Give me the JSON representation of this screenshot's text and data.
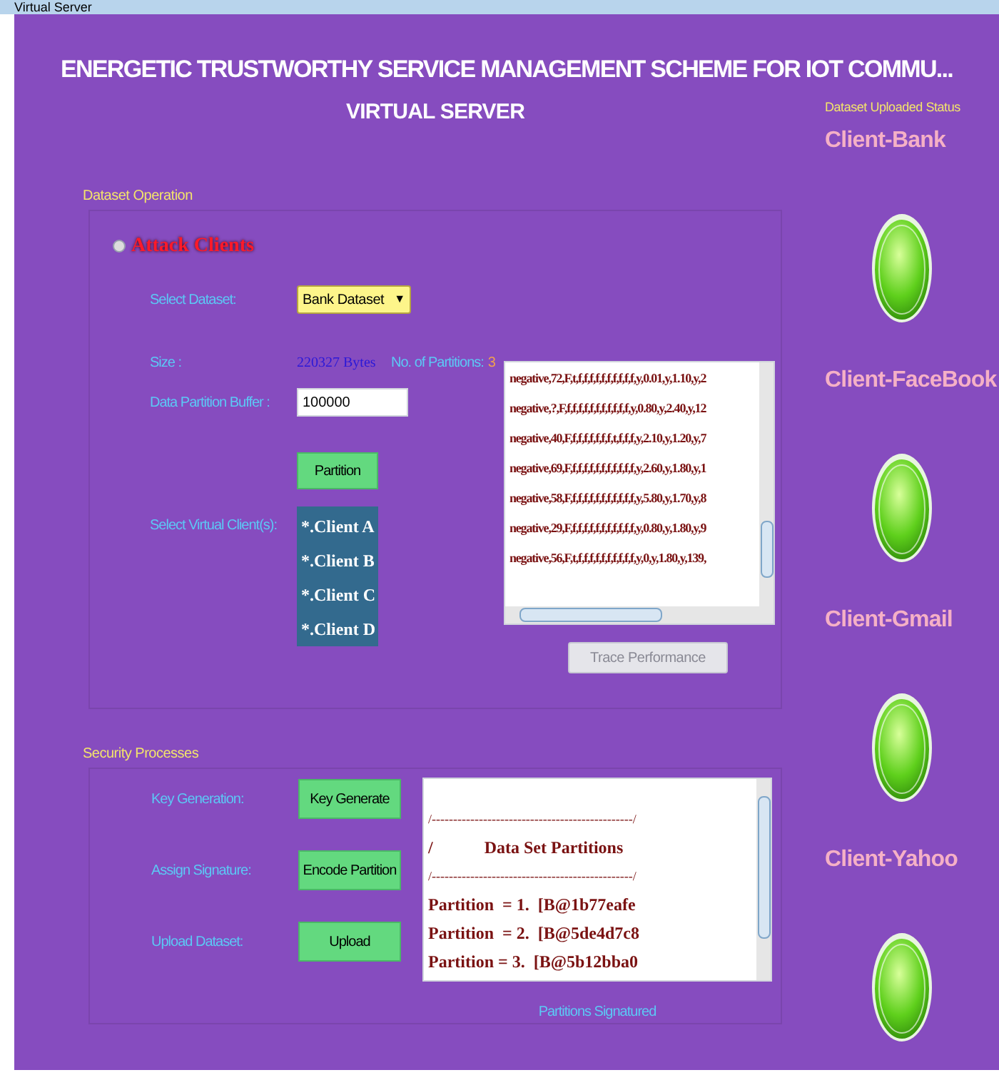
{
  "window": {
    "title": "Virtual Server"
  },
  "header": {
    "title": "ENERGETIC TRUSTWORTHY SERVICE MANAGEMENT SCHEME FOR IOT COMMU...",
    "subtitle": "VIRTUAL SERVER"
  },
  "dataset_operation": {
    "heading": "Dataset Operation",
    "attack_option": {
      "label": "Attack Clients",
      "selected": false
    },
    "select_dataset": {
      "label": "Select Dataset:",
      "value": "Bank Dataset",
      "arrow": "▼"
    },
    "size": {
      "label": "Size :",
      "value": "220327 Bytes"
    },
    "partitions": {
      "label": "No. of Partitions:",
      "value": "3"
    },
    "buffer": {
      "label": "Data Partition Buffer :",
      "value": "100000"
    },
    "partition_button": "Partition",
    "virtual_clients": {
      "label": "Select Virtual Client(s):",
      "items": [
        {
          "label": "*.Client A",
          "selected": false
        },
        {
          "label": "*.Client B",
          "selected": false
        },
        {
          "label": "*.Client C",
          "selected": false
        },
        {
          "label": "*.Client D",
          "selected": false
        }
      ]
    },
    "records": [
      "negative,72,F,t,f,f,f,f,f,f,f,f,f,f,y,0.01,y,1.10,y,2",
      "negative,?,F,f,f,f,f,f,f,f,f,f,f,f,y,0.80,y,2.40,y,12",
      "negative,40,F,f,f,f,f,f,f,f,t,f,f,f,y,2.10,y,1.20,y,7",
      "negative,69,F,f,f,f,f,f,f,f,f,f,f,f,y,2.60,y,1.80,y,1",
      "negative,58,F,f,f,f,f,f,f,f,f,f,f,f,y,5.80,y,1.70,y,8",
      "negative,29,F,f,f,f,f,f,f,f,f,f,f,f,y,0.80,y,1.80,y,9",
      "negative,56,F,t,f,f,f,f,f,f,f,f,f,f,y,0,y,1.80,y,139,"
    ],
    "trace_button": {
      "label": "Trace Performance",
      "disabled": true
    }
  },
  "security_processes": {
    "heading": "Security Processes",
    "steps": [
      {
        "label": "Key Generation:",
        "button": "Key Generate"
      },
      {
        "label": "Assign Signature:",
        "button": "Encode Partition"
      },
      {
        "label": "Upload Dataset:",
        "button": "Upload"
      }
    ],
    "log": [
      {
        "kind": "rule",
        "text": "/-----------------------------------------------/"
      },
      {
        "kind": "title",
        "text": "/            Data Set Partitions"
      },
      {
        "kind": "rule",
        "text": "/-----------------------------------------------/"
      },
      {
        "kind": "entry",
        "text": "Partition  = 1.  [B@1b77eafe"
      },
      {
        "kind": "entry",
        "text": "Partition  = 2.  [B@5de4d7c8"
      },
      {
        "kind": "entry",
        "text": "Partition = 3.  [B@5b12bba0"
      }
    ],
    "caption": "Partitions Signatured"
  },
  "upload_status": {
    "heading": "Dataset Uploaded Status",
    "clients": [
      {
        "name": "Client-Bank",
        "on": true
      },
      {
        "name": "Client-FaceBook",
        "on": true
      },
      {
        "name": "Client-Gmail",
        "on": true
      },
      {
        "name": "Client-Yahoo",
        "on": true
      }
    ]
  }
}
